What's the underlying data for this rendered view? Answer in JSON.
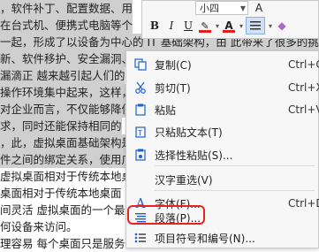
{
  "document": {
    "lines": [
      {
        "text": "，软件补丁、配置数据、用",
        "selected": true
      },
      {
        "text": "在台式机、便携式电脑等个",
        "selected": true
      },
      {
        "text": "一起，形成了以设备为中心的 IT 基础架构，由 此带来了很多的挑",
        "selected": true
      },
      {
        "text": "新、软件移护、安全漏洞、",
        "selected": true
      },
      {
        "text": "漏滴正  越来越引起人们的",
        "selected": true
      },
      {
        "text": "操作环境集中起来，这样，",
        "selected": true
      },
      {
        "text": "对企业而言，不仅能够降低",
        "selected": true
      },
      {
        "text": "求，同时还能保持相同的",
        "selected": true
      },
      {
        "text": "，此，虚拟桌面基础架构是一",
        "selected": true
      },
      {
        "text": "件之间的绑定关系，使用广",
        "selected": true
      },
      {
        "text": "虚拟桌面相对于传统本地桌",
        "selected": false
      },
      {
        "text": "桌面相对于传统本地桌面",
        "selected": false
      },
      {
        "text": "间灵活  虚拟桌面的一个最",
        "selected": false
      },
      {
        "text": "何设备来访问。",
        "selected": false
      },
      {
        "text": "理容易  每个桌面只是服务",
        "selected": false
      }
    ]
  },
  "mini_toolbar": {
    "font_size": "小四",
    "font_size_partial": "A",
    "right_edge_partial": "f",
    "bold": "B",
    "italic": "I",
    "underline": "U",
    "highlight_letter": "A",
    "font_color_letter": "A"
  },
  "context_menu": {
    "items": [
      {
        "label": "复制(C)",
        "shortcut": "Ctrl+C",
        "icon": "copy-icon"
      },
      {
        "label": "剪切(T)",
        "shortcut": "Ctrl+X",
        "icon": "scissors-icon"
      },
      {
        "label": "粘贴",
        "shortcut": "Ctrl+V",
        "icon": "paste-icon"
      },
      {
        "label": "只粘贴文本(T)",
        "shortcut": "",
        "icon": "paste-text-icon"
      },
      {
        "label": "选择性粘贴(S)...",
        "shortcut": "",
        "icon": "paste-special-icon"
      },
      {
        "label": "汉字重选(V)",
        "shortcut": "",
        "icon": ""
      },
      {
        "label": "字体(F)...",
        "shortcut": "Ctrl+D",
        "icon": "font-icon"
      },
      {
        "label": "段落(P)...",
        "shortcut": "",
        "icon": "paragraph-icon",
        "highlighted": true
      },
      {
        "label": "项目符号和编号(N)...",
        "shortcut": "",
        "icon": "bullets-icon"
      }
    ]
  },
  "colors": {
    "selection": "#cfcfcf",
    "highlight_outline": "#e8221c",
    "accent_blue": "#1f5fd1"
  }
}
